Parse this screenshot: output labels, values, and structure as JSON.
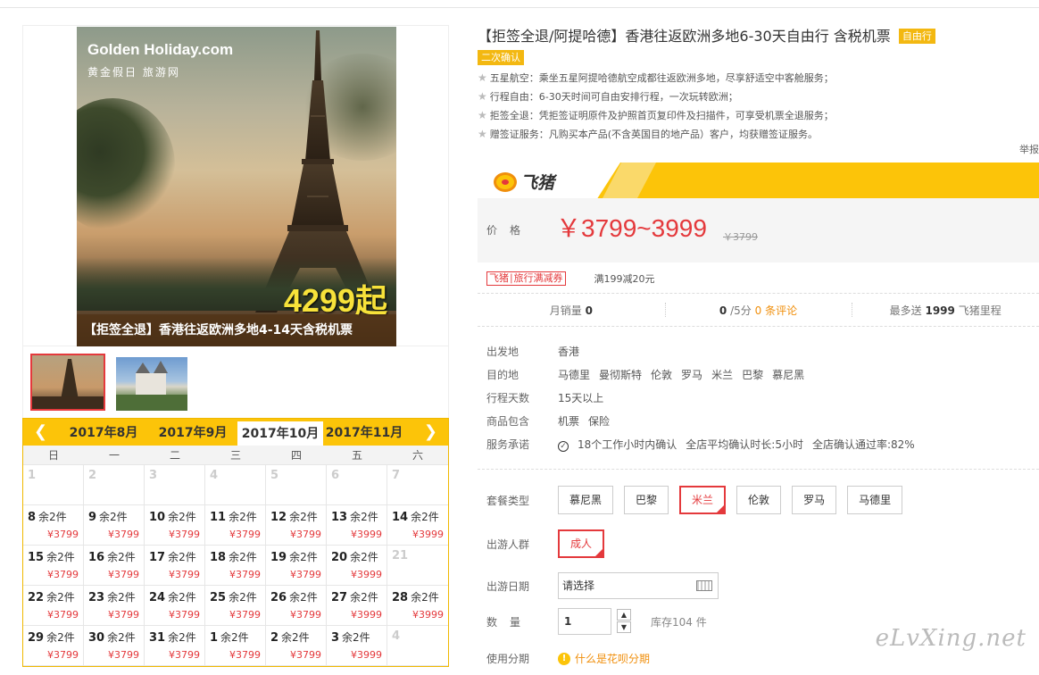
{
  "poster": {
    "logo_line1": "Golden Holiday.com",
    "logo_line2": "黄金假日 旅游网",
    "promo": "4299起",
    "caption": "【拒签全退】香港往返欧洲多地4-14天含税机票"
  },
  "calendar": {
    "prev_icon": "chevron-left-icon",
    "next_icon": "chevron-right-icon",
    "months": [
      "2017年8月",
      "2017年9月",
      "2017年10月",
      "2017年11月"
    ],
    "active_month": "2017年10月",
    "weekdays": [
      "日",
      "一",
      "二",
      "三",
      "四",
      "五",
      "六"
    ],
    "cells": [
      {
        "day": "1",
        "stock": "",
        "price": ""
      },
      {
        "day": "2",
        "stock": "",
        "price": ""
      },
      {
        "day": "3",
        "stock": "",
        "price": ""
      },
      {
        "day": "4",
        "stock": "",
        "price": ""
      },
      {
        "day": "5",
        "stock": "",
        "price": ""
      },
      {
        "day": "6",
        "stock": "",
        "price": ""
      },
      {
        "day": "7",
        "stock": "",
        "price": ""
      },
      {
        "day": "8",
        "stock": "余2件",
        "price": "¥3799"
      },
      {
        "day": "9",
        "stock": "余2件",
        "price": "¥3799"
      },
      {
        "day": "10",
        "stock": "余2件",
        "price": "¥3799"
      },
      {
        "day": "11",
        "stock": "余2件",
        "price": "¥3799"
      },
      {
        "day": "12",
        "stock": "余2件",
        "price": "¥3799"
      },
      {
        "day": "13",
        "stock": "余2件",
        "price": "¥3999"
      },
      {
        "day": "14",
        "stock": "余2件",
        "price": "¥3999"
      },
      {
        "day": "15",
        "stock": "余2件",
        "price": "¥3799"
      },
      {
        "day": "16",
        "stock": "余2件",
        "price": "¥3799"
      },
      {
        "day": "17",
        "stock": "余2件",
        "price": "¥3799"
      },
      {
        "day": "18",
        "stock": "余2件",
        "price": "¥3799"
      },
      {
        "day": "19",
        "stock": "余2件",
        "price": "¥3799"
      },
      {
        "day": "20",
        "stock": "余2件",
        "price": "¥3999"
      },
      {
        "day": "21",
        "stock": "",
        "price": ""
      },
      {
        "day": "22",
        "stock": "余2件",
        "price": "¥3799"
      },
      {
        "day": "23",
        "stock": "余2件",
        "price": "¥3799"
      },
      {
        "day": "24",
        "stock": "余2件",
        "price": "¥3799"
      },
      {
        "day": "25",
        "stock": "余2件",
        "price": "¥3799"
      },
      {
        "day": "26",
        "stock": "余2件",
        "price": "¥3799"
      },
      {
        "day": "27",
        "stock": "余2件",
        "price": "¥3999"
      },
      {
        "day": "28",
        "stock": "余2件",
        "price": "¥3999"
      },
      {
        "day": "29",
        "stock": "余2件",
        "price": "¥3799"
      },
      {
        "day": "30",
        "stock": "余2件",
        "price": "¥3799"
      },
      {
        "day": "31",
        "stock": "余2件",
        "price": "¥3799"
      },
      {
        "day": "1",
        "stock": "余2件",
        "price": "¥3799"
      },
      {
        "day": "2",
        "stock": "余2件",
        "price": "¥3799"
      },
      {
        "day": "3",
        "stock": "余2件",
        "price": "¥3999"
      },
      {
        "day": "4",
        "stock": "",
        "price": ""
      }
    ]
  },
  "product": {
    "title": "【拒签全退/阿提哈德】香港往返欧洲多地6-30天自由行 含税机票",
    "tag": "自由行",
    "tag2": "二次确认",
    "features": [
      "五星航空：乘坐五星阿提哈德航空成都往返欧洲多地，尽享舒适空中客舱服务；",
      "行程自由：6-30天时间可自由安排行程，一次玩转欧洲；",
      "拒签全退：凭拒签证明原件及护照首页复印件及扫描件，可享受机票全退服务；",
      "赠签证服务：凡购买本产品(不含英国目的地产品）客户，均获赠签证服务。"
    ],
    "report": "举报"
  },
  "price": {
    "brand": "飞猪",
    "label": "价格",
    "main": "￥3799~3999",
    "original": "￥3799"
  },
  "coupon": {
    "badge": "飞猪∣旅行满减券",
    "text": "满199减20元"
  },
  "stats": {
    "monthly_label": "月销量",
    "monthly_value": "0",
    "score_value": "0",
    "score_suffix": "/5分",
    "reviews": "0 条评论",
    "miles_prefix": "最多送",
    "miles_value": "1999",
    "miles_suffix": "飞猪里程"
  },
  "attrs": [
    {
      "key": "出发地",
      "values": [
        "香港"
      ]
    },
    {
      "key": "目的地",
      "values": [
        "马德里",
        "曼彻斯特",
        "伦敦",
        "罗马",
        "米兰",
        "巴黎",
        "慕尼黑"
      ]
    },
    {
      "key": "行程天数",
      "values": [
        "15天以上"
      ]
    },
    {
      "key": "商品包含",
      "values": [
        "机票",
        "保险"
      ]
    },
    {
      "key": "服务承诺",
      "values": [
        "18个工作小时内确认",
        "全店平均确认时长:5小时",
        "全店确认通过率:82%"
      ]
    }
  ],
  "options": {
    "package_label": "套餐类型",
    "packages": [
      "慕尼黑",
      "巴黎",
      "米兰",
      "伦敦",
      "罗马",
      "马德里"
    ],
    "package_selected": "米兰",
    "crowd_label": "出游人群",
    "crowd": [
      "成人"
    ],
    "date_label": "出游日期",
    "date_placeholder": "请选择",
    "qty_label": "数量",
    "qty_value": "1",
    "stock_text": "库存104 件",
    "installment_label": "使用分期",
    "huabei_text": "什么是花呗分期"
  },
  "watermark": "eLvXing.net"
}
